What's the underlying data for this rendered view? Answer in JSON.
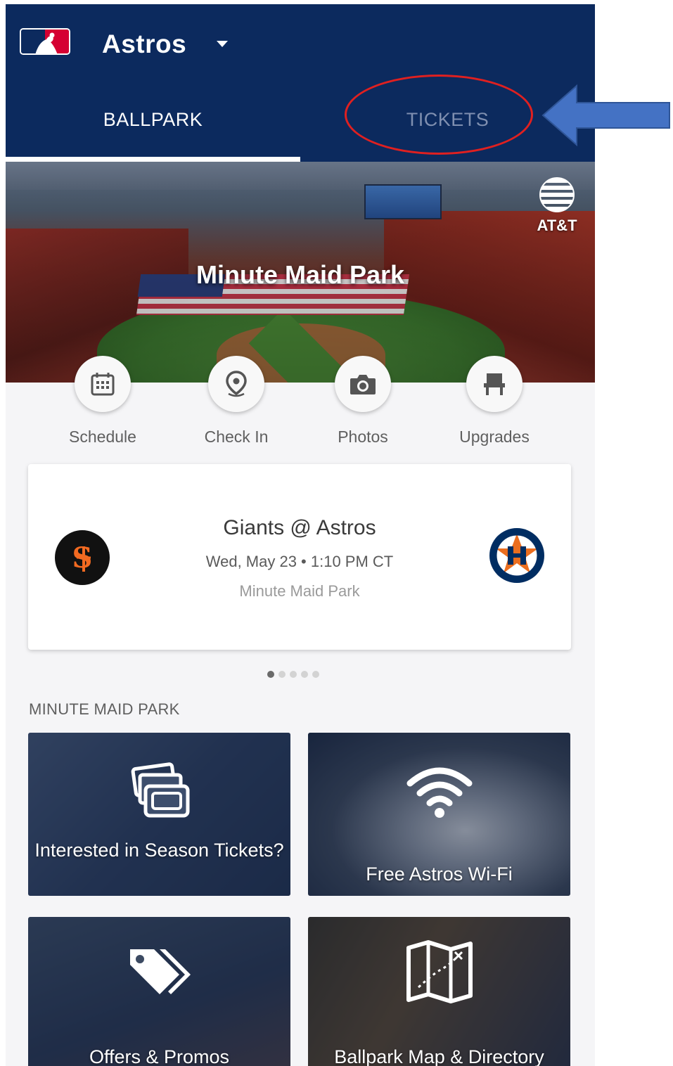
{
  "header": {
    "team": "Astros",
    "tabs": [
      {
        "label": "BALLPARK",
        "active": true
      },
      {
        "label": "TICKETS",
        "active": false
      }
    ],
    "accent_color": "#0c2a5e"
  },
  "hero": {
    "title": "Minute Maid Park",
    "sponsor": "AT&T"
  },
  "quick_actions": [
    {
      "label": "Schedule",
      "icon": "calendar-icon"
    },
    {
      "label": "Check In",
      "icon": "location-pin-icon"
    },
    {
      "label": "Photos",
      "icon": "camera-icon"
    },
    {
      "label": "Upgrades",
      "icon": "seat-icon"
    }
  ],
  "game": {
    "title": "Giants @ Astros",
    "time": "Wed, May 23 • 1:10 PM CT",
    "venue": "Minute Maid Park",
    "away_logo": "giants-logo",
    "home_logo": "astros-logo"
  },
  "carousel": {
    "count": 5,
    "active": 1
  },
  "section": {
    "title": "MINUTE MAID PARK",
    "tiles": [
      {
        "label": "Interested in Season Tickets?",
        "icon": "tickets-icon"
      },
      {
        "label": "Free Astros Wi-Fi",
        "icon": "wifi-icon"
      },
      {
        "label": "Offers & Promos",
        "icon": "tags-icon"
      },
      {
        "label": "Ballpark Map & Directory",
        "icon": "map-icon"
      }
    ]
  },
  "annotation": {
    "ellipse_color": "#e02020",
    "arrow_color": "#4472c4"
  }
}
